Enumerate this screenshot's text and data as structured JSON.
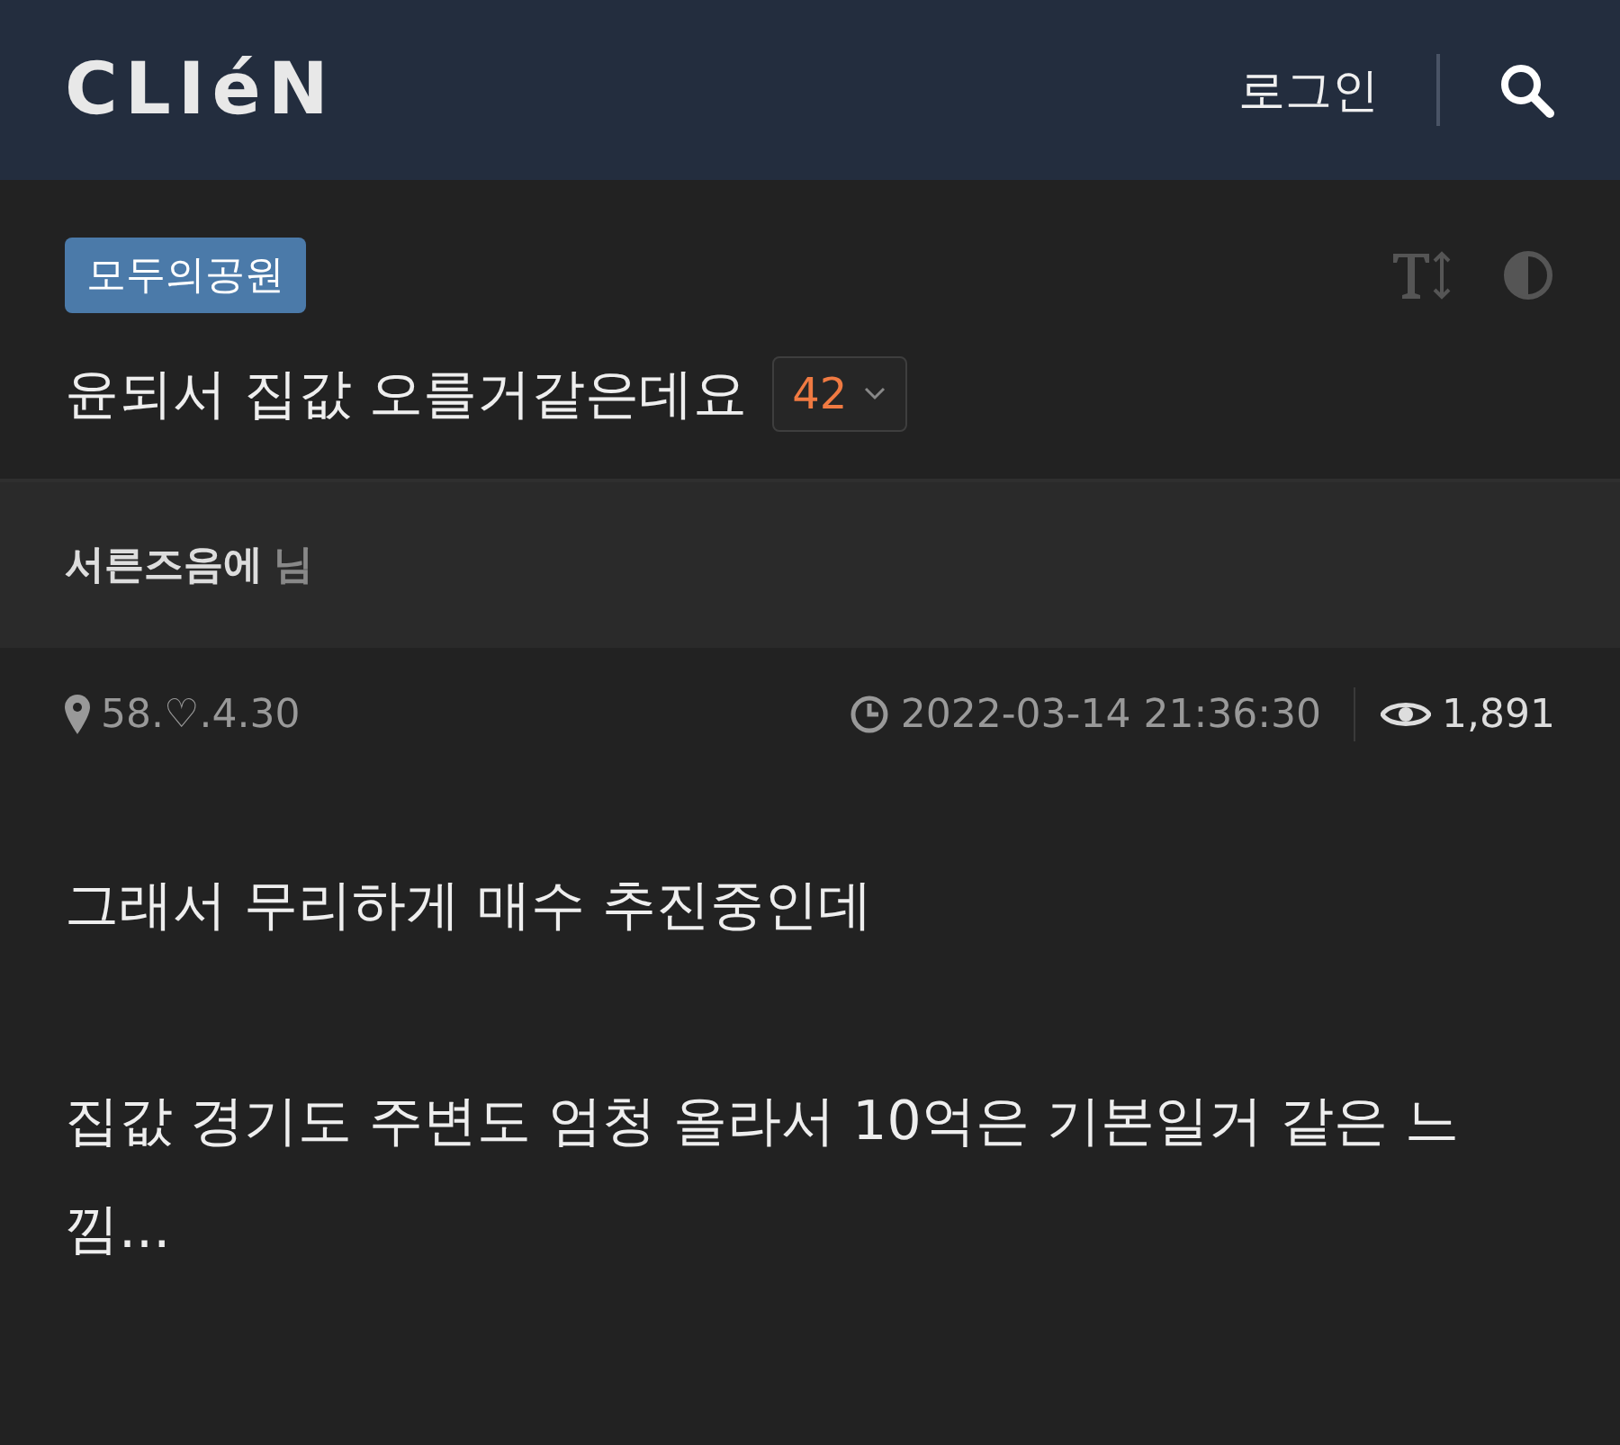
{
  "header": {
    "logo": "CLIéN",
    "login": "로그인"
  },
  "post": {
    "board": "모두의공원",
    "title": "윤되서 집값 오를거같은데요",
    "comment_count": "42"
  },
  "author": {
    "nickname": "서른즈음에",
    "suffix": "님"
  },
  "meta": {
    "ip": "58.♡.4.30",
    "datetime": "2022-03-14 21:36:30",
    "views": "1,891"
  },
  "body": [
    "그래서 무리하게 매수 추진중인데",
    "집값 경기도 주변도 엄청 올라서 10억은 기본일거 같은 느낌..."
  ]
}
